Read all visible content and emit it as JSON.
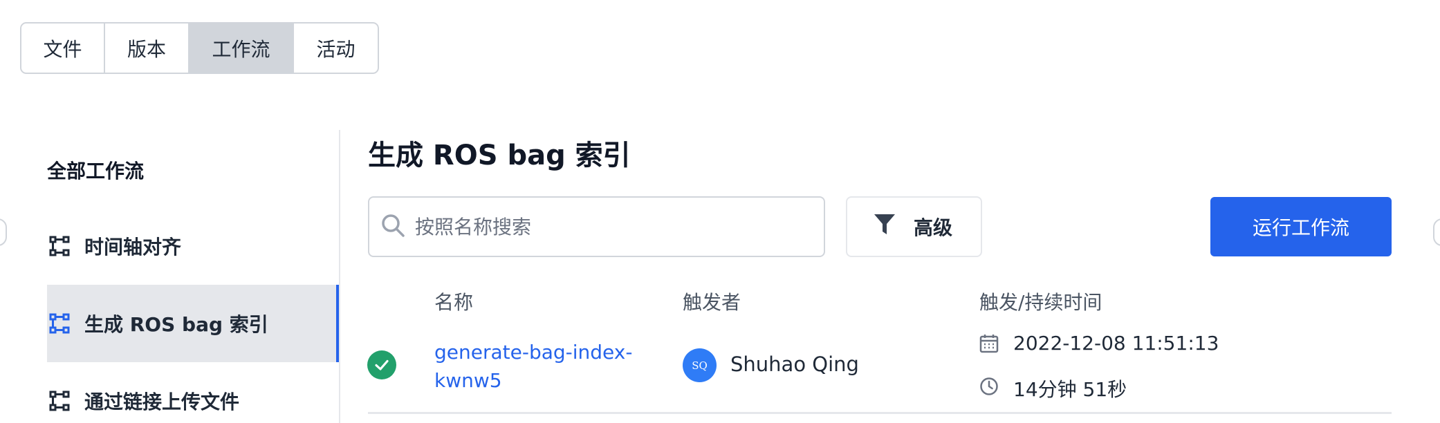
{
  "tabs": [
    {
      "label": "文件"
    },
    {
      "label": "版本"
    },
    {
      "label": "工作流",
      "active": true
    },
    {
      "label": "活动"
    }
  ],
  "sidebar": {
    "title": "全部工作流",
    "items": [
      {
        "label": "时间轴对齐",
        "icon": "workflow-icon"
      },
      {
        "label": "生成 ROS bag 索引",
        "icon": "workflow-icon",
        "active": true
      },
      {
        "label": "通过链接上传文件",
        "icon": "workflow-icon"
      }
    ]
  },
  "main": {
    "title": "生成 ROS bag 索引",
    "search": {
      "placeholder": "按照名称搜索",
      "value": ""
    },
    "advanced_label": "高级",
    "run_label": "运行工作流"
  },
  "table": {
    "columns": [
      "名称",
      "触发者",
      "触发/持续时间"
    ],
    "rows": [
      {
        "status": "success",
        "name": "generate-bag-index-kwnw5",
        "avatar_initials": "SQ",
        "trigger_user": "Shuhao Qing",
        "triggered_at": "2022-12-08 11:51:13",
        "duration": "14分钟 51秒"
      }
    ]
  },
  "colors": {
    "accent": "#2563eb",
    "success": "#22a06b",
    "active_tab_bg": "#d1d5db",
    "avatar_bg": "#2f7cf6"
  }
}
